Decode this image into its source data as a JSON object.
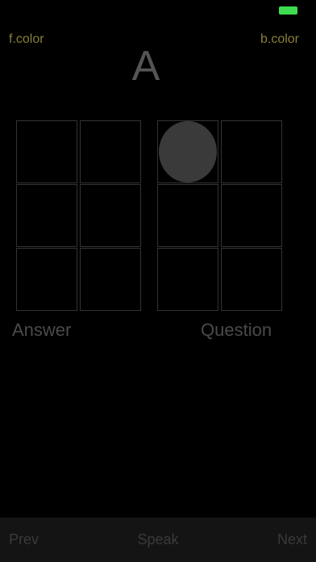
{
  "status_bar": {
    "battery_color": "#3ddc4f"
  },
  "header": {
    "foreground_color_label": "f.color",
    "background_color_label": "b.color",
    "current_letter": "A"
  },
  "colors": {
    "accent_text": "#8a7f3a",
    "filled_dot": "#3a3a3a",
    "grid_line": "#333333",
    "background": "#000000"
  },
  "answer_grid": {
    "label": "Answer",
    "cells": [
      false,
      false,
      false,
      false,
      false,
      false
    ]
  },
  "question_grid": {
    "label": "Question",
    "cells": [
      true,
      false,
      false,
      false,
      false,
      false
    ]
  },
  "bottom_bar": {
    "prev_label": "Prev",
    "speak_label": "Speak",
    "next_label": "Next"
  }
}
